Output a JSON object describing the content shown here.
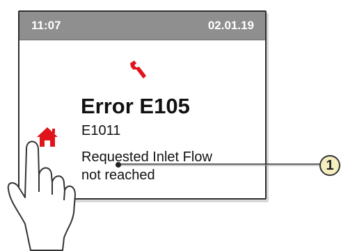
{
  "status_bar": {
    "time": "11:07",
    "date": "02.01.19",
    "background": "#8f8f8f"
  },
  "error": {
    "title": "Error E105",
    "code": "E1011",
    "message_line1": "Requested Inlet Flow",
    "message_line2": "not reached"
  },
  "icons": {
    "tool": "wrench-icon",
    "home": "home-icon",
    "hand": "pointing-hand-icon"
  },
  "callout": {
    "number": "1",
    "color": "#f5efc0"
  },
  "accent_color": "#e0151c"
}
